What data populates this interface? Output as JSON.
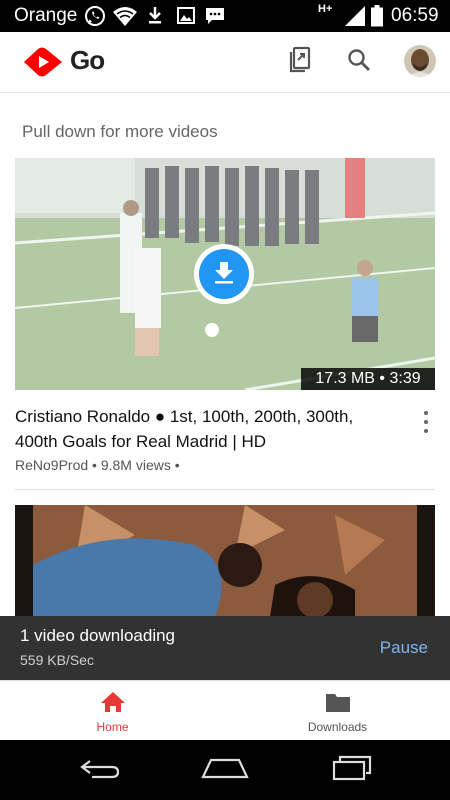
{
  "status_bar": {
    "carrier": "Orange",
    "network": "H+",
    "time": "06:59"
  },
  "app_bar": {
    "logo_text": "Go",
    "icons": [
      "youtube-logo-icon",
      "clipboard-share-icon",
      "search-icon",
      "avatar"
    ]
  },
  "feed": {
    "pull_hint": "Pull down for more videos",
    "videos": [
      {
        "badge": "17.3 MB • 3:39",
        "title": "Cristiano Ronaldo ● 1st, 100th, 200th, 300th, 400th Goals for Real Madrid | HD",
        "meta": "ReNo9Prod • 9.8M views •"
      }
    ]
  },
  "snackbar": {
    "text": "1 video downloading",
    "subtext": "559 KB/Sec",
    "action": "Pause"
  },
  "bottom_nav": {
    "items": [
      {
        "label": "Home",
        "icon": "home-icon",
        "active": true
      },
      {
        "label": "Downloads",
        "icon": "folder-icon",
        "active": false
      }
    ]
  },
  "system_nav": [
    "back-icon",
    "home-icon",
    "recents-icon"
  ],
  "colors": {
    "brand_red": "#ff0000",
    "download_blue": "#2196f3",
    "snackbar_bg": "#323232",
    "snackbar_action": "#7fb4ea",
    "nav_active": "#e53935",
    "nav_inactive": "#555555"
  }
}
